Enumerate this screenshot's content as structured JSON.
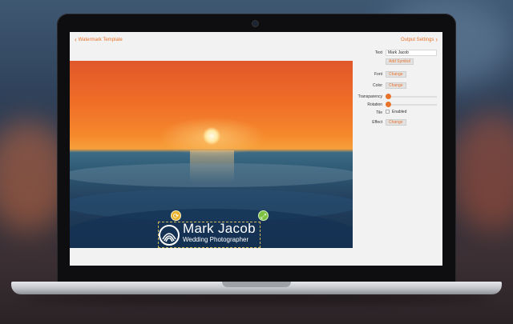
{
  "header": {
    "back_label": "Watermark Template",
    "next_label": "Output Settings"
  },
  "watermark": {
    "title": "Mark Jacob",
    "subtitle": "Wedding Photographer"
  },
  "settings": {
    "text": {
      "label": "Text",
      "value": "Mark Jacob",
      "add_symbol": "Add Symbol"
    },
    "font": {
      "label": "Font",
      "button": "Change"
    },
    "color": {
      "label": "Color",
      "button": "Change"
    },
    "transparency": {
      "label": "Transparency",
      "value": 0
    },
    "rotation": {
      "label": "Rotation",
      "value": 0
    },
    "tile": {
      "label": "Tile",
      "option": "Enabled",
      "checked": false
    },
    "effect": {
      "label": "Effect",
      "button": "Change"
    }
  },
  "colors": {
    "accent": "#e8732a"
  }
}
